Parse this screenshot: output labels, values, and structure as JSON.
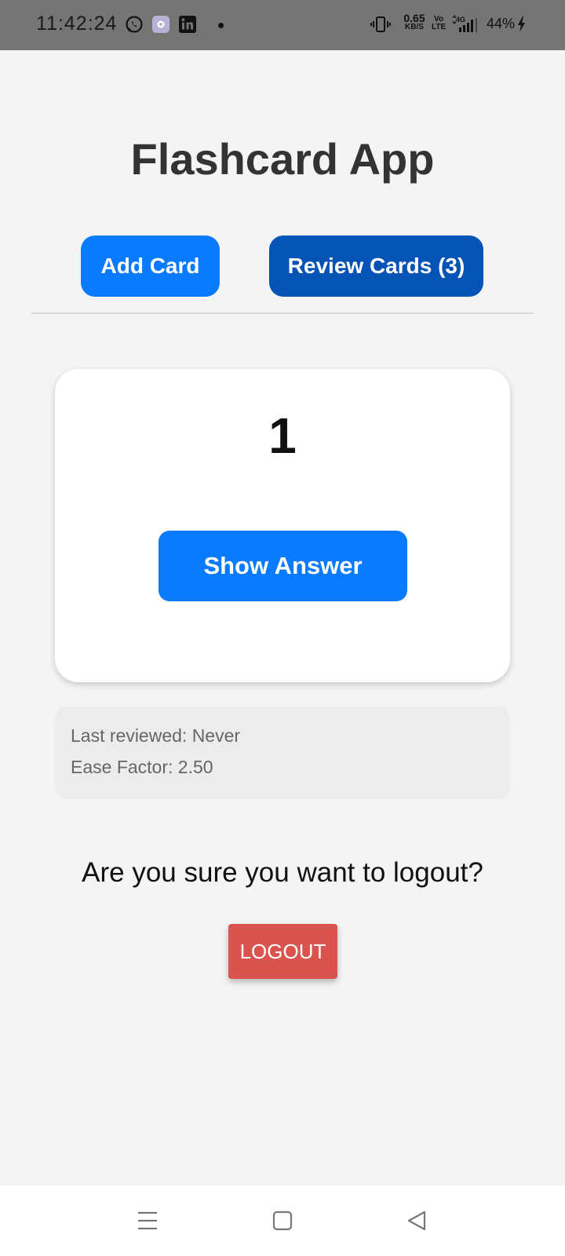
{
  "status_bar": {
    "time": "11:42:24",
    "speed_value": "0.65",
    "speed_unit": "KB/S",
    "volte_top": "Vo",
    "volte_bottom": "LTE",
    "network": "4G",
    "battery": "44%",
    "icons": [
      "whatsapp-icon",
      "app-icon",
      "linkedin-icon",
      "notification-dot",
      "vibrate-icon",
      "signal-icon",
      "charging-icon"
    ]
  },
  "app": {
    "title": "Flashcard App",
    "add_card_label": "Add Card",
    "review_cards_label": "Review Cards (3)"
  },
  "card": {
    "front_text": "1",
    "show_answer_label": "Show Answer"
  },
  "info": {
    "last_reviewed": "Last reviewed: Never",
    "ease_factor": "Ease Factor: 2.50"
  },
  "logout": {
    "question": "Are you sure you want to logout?",
    "button_label": "LOGOUT"
  },
  "nav_bar": {
    "icons": [
      "menu-icon",
      "home-icon",
      "back-icon"
    ]
  },
  "colors": {
    "primary": "#0a7bff",
    "primary_dark": "#0554b5",
    "danger": "#d9534f",
    "background": "#f4f4f4"
  }
}
